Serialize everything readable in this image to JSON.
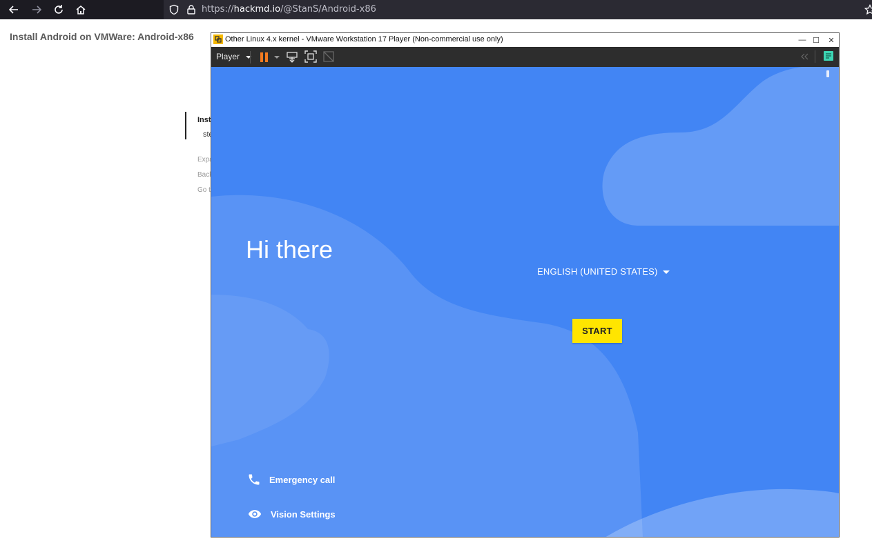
{
  "browser": {
    "url_scheme": "https://",
    "url_host": "hackmd.io",
    "url_path": "/@StanS/Android-x86"
  },
  "page": {
    "title": "Install Android on VMWare: Android-x86",
    "toc": [
      "Inst",
      "ste",
      "Expa",
      "Back",
      "Go t"
    ]
  },
  "vmware": {
    "title": "Other Linux 4.x kernel - VMware Workstation 17 Player (Non-commercial use only)",
    "player_label": "Player",
    "window_controls": [
      "—",
      "☐",
      "✕"
    ]
  },
  "android": {
    "greeting": "Hi there",
    "language": "ENGLISH (UNITED STATES)",
    "start_label": "START",
    "emergency_label": "Emergency call",
    "vision_label": "Vision Settings"
  },
  "colors": {
    "android_blue": "#4285f4",
    "start_yellow": "#ffe500",
    "pause_orange": "#f47a20",
    "fullscreen_icon_teal": "#3dd6b5"
  }
}
